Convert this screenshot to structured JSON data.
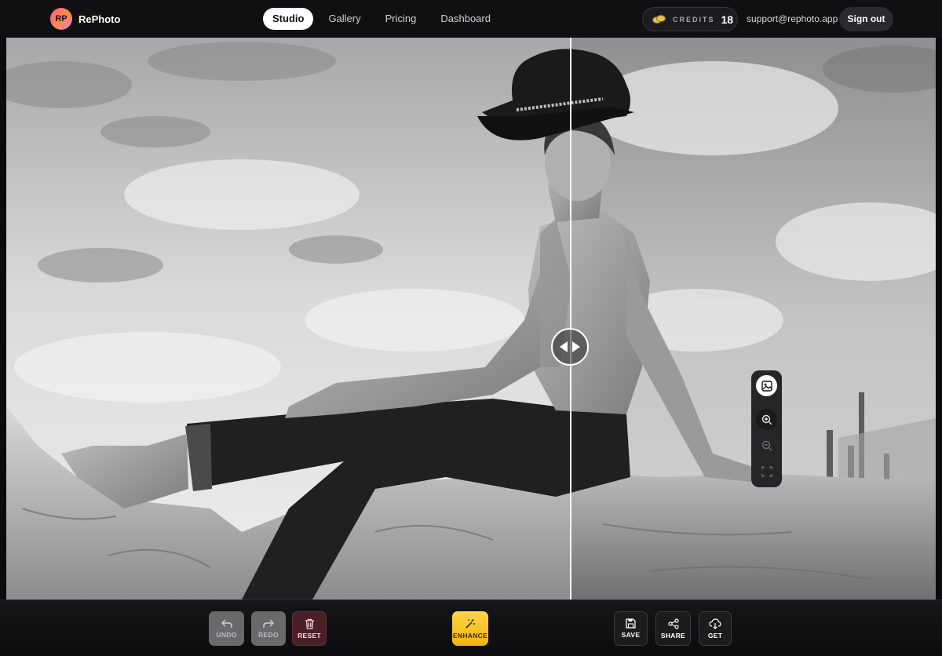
{
  "brand": {
    "logo_text": "RP",
    "name": "RePhoto"
  },
  "nav": {
    "items": [
      {
        "label": "Studio",
        "active": true
      },
      {
        "label": "Gallery",
        "active": false
      },
      {
        "label": "Pricing",
        "active": false
      },
      {
        "label": "Dashboard",
        "active": false
      }
    ]
  },
  "account": {
    "credits_label": "CREDITS",
    "credits_count": "18",
    "email": "support@rephoto.app",
    "sign_out_label": "Sign out"
  },
  "editor": {
    "view_mode": "before/after compare",
    "zoom_tools": [
      "image-icon",
      "zoom-in-icon",
      "zoom-out-icon",
      "fullscreen-icon"
    ]
  },
  "toolbar": {
    "undo_label": "UNDO",
    "redo_label": "REDO",
    "reset_label": "RESET",
    "enhance_label": "ENHANCE",
    "save_label": "SAVE",
    "share_label": "SHARE",
    "get_label": "GET"
  },
  "colors": {
    "accent": "#f5b40c",
    "reset": "#4a2028",
    "background": "#0b0b0c"
  }
}
